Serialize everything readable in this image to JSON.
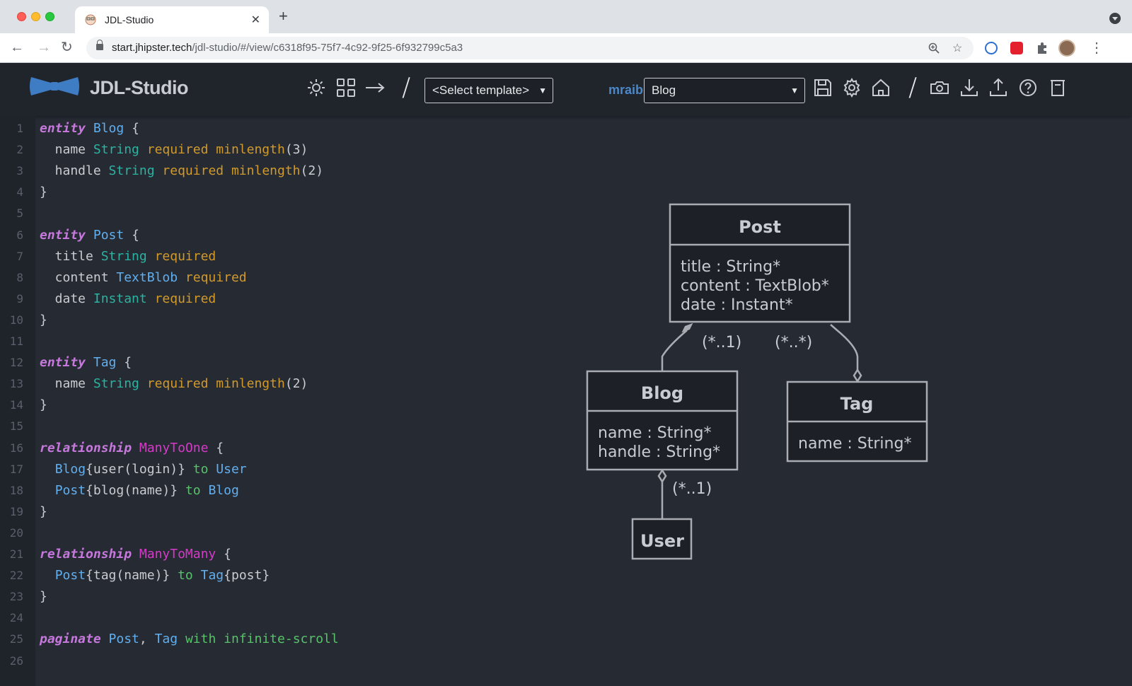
{
  "browser": {
    "tab_title": "JDL-Studio",
    "url_host": "start.jhipster.tech",
    "url_path": "/jdl-studio/#/view/c6318f95-75f7-4c92-9f25-6f932799c5a3"
  },
  "app": {
    "title": "JDL-Studio",
    "template_select": "<Select template>",
    "username": "mraible",
    "model_select": "Blog"
  },
  "editor": {
    "lines": [
      {
        "n": "1",
        "html": "<span class=\"kw\">entity</span> <span class=\"ent\">Blog</span> {"
      },
      {
        "n": "2",
        "html": "  name <span class=\"typ\">String</span> <span class=\"val\">required</span> <span class=\"val\">minlength</span>(3)"
      },
      {
        "n": "3",
        "html": "  handle <span class=\"typ\">String</span> <span class=\"val\">required</span> <span class=\"val\">minlength</span>(2)"
      },
      {
        "n": "4",
        "html": "}"
      },
      {
        "n": "5",
        "html": ""
      },
      {
        "n": "6",
        "html": "<span class=\"kw\">entity</span> <span class=\"ent\">Post</span> {"
      },
      {
        "n": "7",
        "html": "  title <span class=\"typ\">String</span> <span class=\"val\">required</span>"
      },
      {
        "n": "8",
        "html": "  content <span class=\"ent\">TextBlob</span> <span class=\"val\">required</span>"
      },
      {
        "n": "9",
        "html": "  date <span class=\"typ\">Instant</span> <span class=\"val\">required</span>"
      },
      {
        "n": "10",
        "html": "}"
      },
      {
        "n": "11",
        "html": ""
      },
      {
        "n": "12",
        "html": "<span class=\"kw\">entity</span> <span class=\"ent\">Tag</span> {"
      },
      {
        "n": "13",
        "html": "  name <span class=\"typ\">String</span> <span class=\"val\">required</span> <span class=\"val\">minlength</span>(2)"
      },
      {
        "n": "14",
        "html": "}"
      },
      {
        "n": "15",
        "html": ""
      },
      {
        "n": "16",
        "html": "<span class=\"kw\">relationship</span> <span class=\"rel\">ManyToOne</span> {"
      },
      {
        "n": "17",
        "html": "  <span class=\"ent\">Blog</span>{user(login)} <span class=\"to\">to</span> <span class=\"ent\">User</span>"
      },
      {
        "n": "18",
        "html": "  <span class=\"ent\">Post</span>{blog(name)} <span class=\"to\">to</span> <span class=\"ent\">Blog</span>"
      },
      {
        "n": "19",
        "html": "}"
      },
      {
        "n": "20",
        "html": ""
      },
      {
        "n": "21",
        "html": "<span class=\"kw\">relationship</span> <span class=\"rel\">ManyToMany</span> {"
      },
      {
        "n": "22",
        "html": "  <span class=\"ent\">Post</span>{tag(name)} <span class=\"to\">to</span> <span class=\"ent\">Tag</span>{post}"
      },
      {
        "n": "23",
        "html": "}"
      },
      {
        "n": "24",
        "html": ""
      },
      {
        "n": "25",
        "html": "<span class=\"kw\">paginate</span> <span class=\"ent\">Post</span>, <span class=\"ent\">Tag</span> <span class=\"to\">with</span> <span class=\"to\">infinite-scroll</span>"
      },
      {
        "n": "26",
        "html": ""
      }
    ]
  },
  "diagram": {
    "post": {
      "name": "Post",
      "fields": [
        "title : String*",
        "content : TextBlob*",
        "date : Instant*"
      ]
    },
    "blog": {
      "name": "Blog",
      "fields": [
        "name : String*",
        "handle : String*"
      ]
    },
    "tag": {
      "name": "Tag",
      "fields": [
        "name : String*"
      ]
    },
    "user": {
      "name": "User"
    },
    "labels": {
      "post_blog": "(*..1)",
      "post_tag": "(*..*)",
      "blog_user": "(*..1)"
    }
  }
}
